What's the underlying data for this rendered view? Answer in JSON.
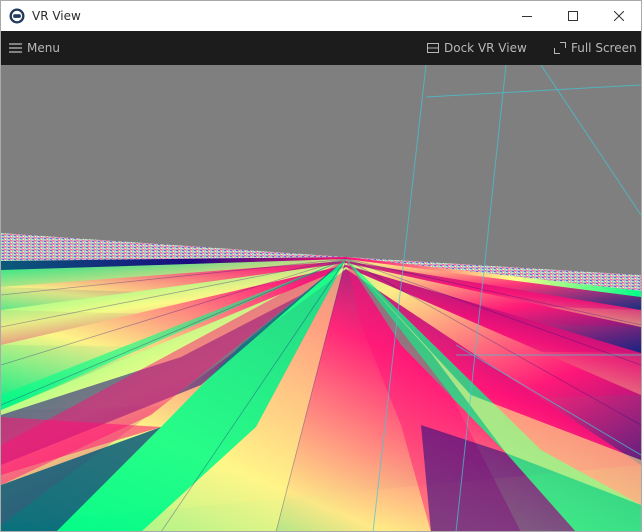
{
  "window": {
    "title": "VR View",
    "app_icon": "vr-logo-icon",
    "controls": {
      "minimize_icon": "minimize-icon",
      "maximize_icon": "maximize-icon",
      "close_icon": "close-icon"
    }
  },
  "toolbar": {
    "menu_label": "Menu",
    "menu_icon": "hamburger-menu-icon",
    "dock_label": "Dock VR View",
    "dock_icon": "dock-window-icon",
    "fullscreen_label": "Full Screen",
    "fullscreen_icon": "expand-icon"
  },
  "viewport": {
    "scene": "tracking-space-floor-grid",
    "sky_color": "#7f7f7f",
    "floor_colors": [
      "#00ff88",
      "#ffff88",
      "#ff1177",
      "#1a0a80",
      "#0a5a7a"
    ],
    "boundary_line_color": "#40c8d8"
  }
}
